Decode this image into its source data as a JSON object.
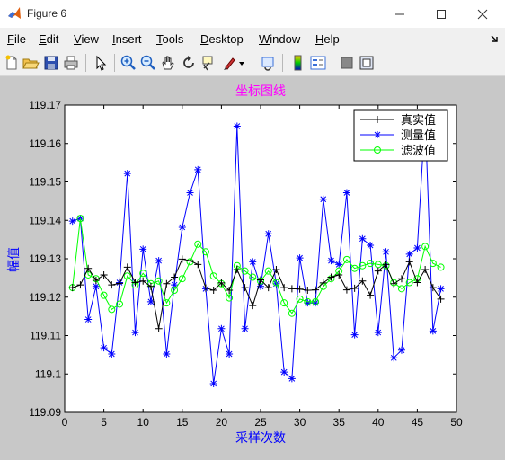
{
  "window": {
    "title": "Figure 6",
    "minimize_icon": "minimize-icon",
    "maximize_icon": "maximize-icon",
    "close_icon": "close-icon"
  },
  "menu": [
    {
      "label": "File",
      "key": "F"
    },
    {
      "label": "Edit",
      "key": "E"
    },
    {
      "label": "View",
      "key": "V"
    },
    {
      "label": "Insert",
      "key": "I"
    },
    {
      "label": "Tools",
      "key": "T"
    },
    {
      "label": "Desktop",
      "key": "D"
    },
    {
      "label": "Window",
      "key": "W"
    },
    {
      "label": "Help",
      "key": "H"
    }
  ],
  "toolbar_icons": [
    "new-figure-icon",
    "open-file-icon",
    "save-icon",
    "print-icon",
    "pointer-icon",
    "zoom-in-icon",
    "zoom-out-icon",
    "pan-icon",
    "rotate-icon",
    "data-cursor-icon",
    "brush-icon",
    "link-plot-icon",
    "colorbar-icon",
    "legend-icon",
    "hide-plot-tools-icon",
    "show-plot-tools-icon"
  ],
  "colors": {
    "true": "#000000",
    "meas": "#0000ff",
    "filt": "#00ff00",
    "title": "#ff00ff",
    "label": "#0000ff"
  },
  "chart_data": {
    "type": "line",
    "title": "坐标图线",
    "xlabel": "采样次数",
    "ylabel": "幅值",
    "xlim": [
      0,
      50
    ],
    "ylim": [
      119.09,
      119.17
    ],
    "xticks": [
      0,
      5,
      10,
      15,
      20,
      25,
      30,
      35,
      40,
      45,
      50
    ],
    "yticks": [
      119.09,
      119.1,
      119.11,
      119.12,
      119.13,
      119.14,
      119.15,
      119.16,
      119.17
    ],
    "ytick_labels": [
      "119.09",
      "119.1",
      "119.11",
      "119.12",
      "119.13",
      "119.14",
      "119.15",
      "119.16",
      "119.17"
    ],
    "legend_position": "top-right",
    "x": [
      1,
      2,
      3,
      4,
      5,
      6,
      7,
      8,
      9,
      10,
      11,
      12,
      13,
      14,
      15,
      16,
      17,
      18,
      19,
      20,
      21,
      22,
      23,
      24,
      25,
      26,
      27,
      28,
      29,
      30,
      31,
      32,
      33,
      34,
      35,
      36,
      37,
      38,
      39,
      40,
      41,
      42,
      43,
      44,
      45,
      46,
      47,
      48
    ],
    "series": [
      {
        "name": "真实值",
        "marker": "plus",
        "values": [
          119.1225,
          119.1232,
          119.1275,
          119.1244,
          119.1258,
          119.1232,
          119.1236,
          119.1278,
          119.1238,
          119.1242,
          119.1228,
          119.1118,
          119.1235,
          119.1252,
          119.1299,
          119.1295,
          119.1285,
          119.1224,
          119.1218,
          119.1237,
          119.1218,
          119.1272,
          119.1225,
          119.1178,
          119.1245,
          119.1225,
          119.1272,
          119.1225,
          119.1222,
          119.1221,
          119.1218,
          119.1219,
          119.1237,
          119.1252,
          119.1258,
          119.1219,
          119.1223,
          119.1242,
          119.1205,
          119.1268,
          119.1285,
          119.1235,
          119.1248,
          119.1292,
          119.1238,
          119.1272,
          119.1225,
          119.1195
        ]
      },
      {
        "name": "测量值",
        "marker": "asterisk",
        "values": [
          119.1398,
          119.1405,
          119.1142,
          119.1228,
          119.1068,
          119.1052,
          119.1238,
          119.1522,
          119.1108,
          119.1325,
          119.1188,
          119.1295,
          119.1052,
          119.1232,
          119.1382,
          119.1472,
          119.1532,
          119.1222,
          119.0975,
          119.1118,
          119.1052,
          119.1645,
          119.1118,
          119.1292,
          119.1228,
          119.1365,
          119.1235,
          119.1005,
          119.0988,
          119.1302,
          119.1185,
          119.1185,
          119.1455,
          119.1295,
          119.1285,
          119.1472,
          119.1102,
          119.1352,
          119.1335,
          119.1108,
          119.1318,
          119.1042,
          119.1062,
          119.1312,
          119.1328,
          119.1672,
          119.1112,
          119.1222
        ]
      },
      {
        "name": "滤波值",
        "marker": "circle",
        "values": [
          119.1225,
          119.1405,
          119.1258,
          119.1248,
          119.1205,
          119.1168,
          119.1182,
          119.1255,
          119.1232,
          119.1262,
          119.1235,
          119.1242,
          119.1185,
          119.1218,
          119.1248,
          119.1292,
          119.1338,
          119.1318,
          119.1255,
          119.1235,
          119.1198,
          119.1282,
          119.1268,
          119.1252,
          119.1242,
          119.1268,
          119.1238,
          119.1185,
          119.1158,
          119.1195,
          119.1188,
          119.1188,
          119.1228,
          119.1248,
          119.1268,
          119.1298,
          119.1275,
          119.1282,
          119.1288,
          119.1285,
          119.1282,
          119.1238,
          119.1222,
          119.1238,
          119.1248,
          119.1332,
          119.1288,
          119.1278
        ]
      }
    ]
  }
}
